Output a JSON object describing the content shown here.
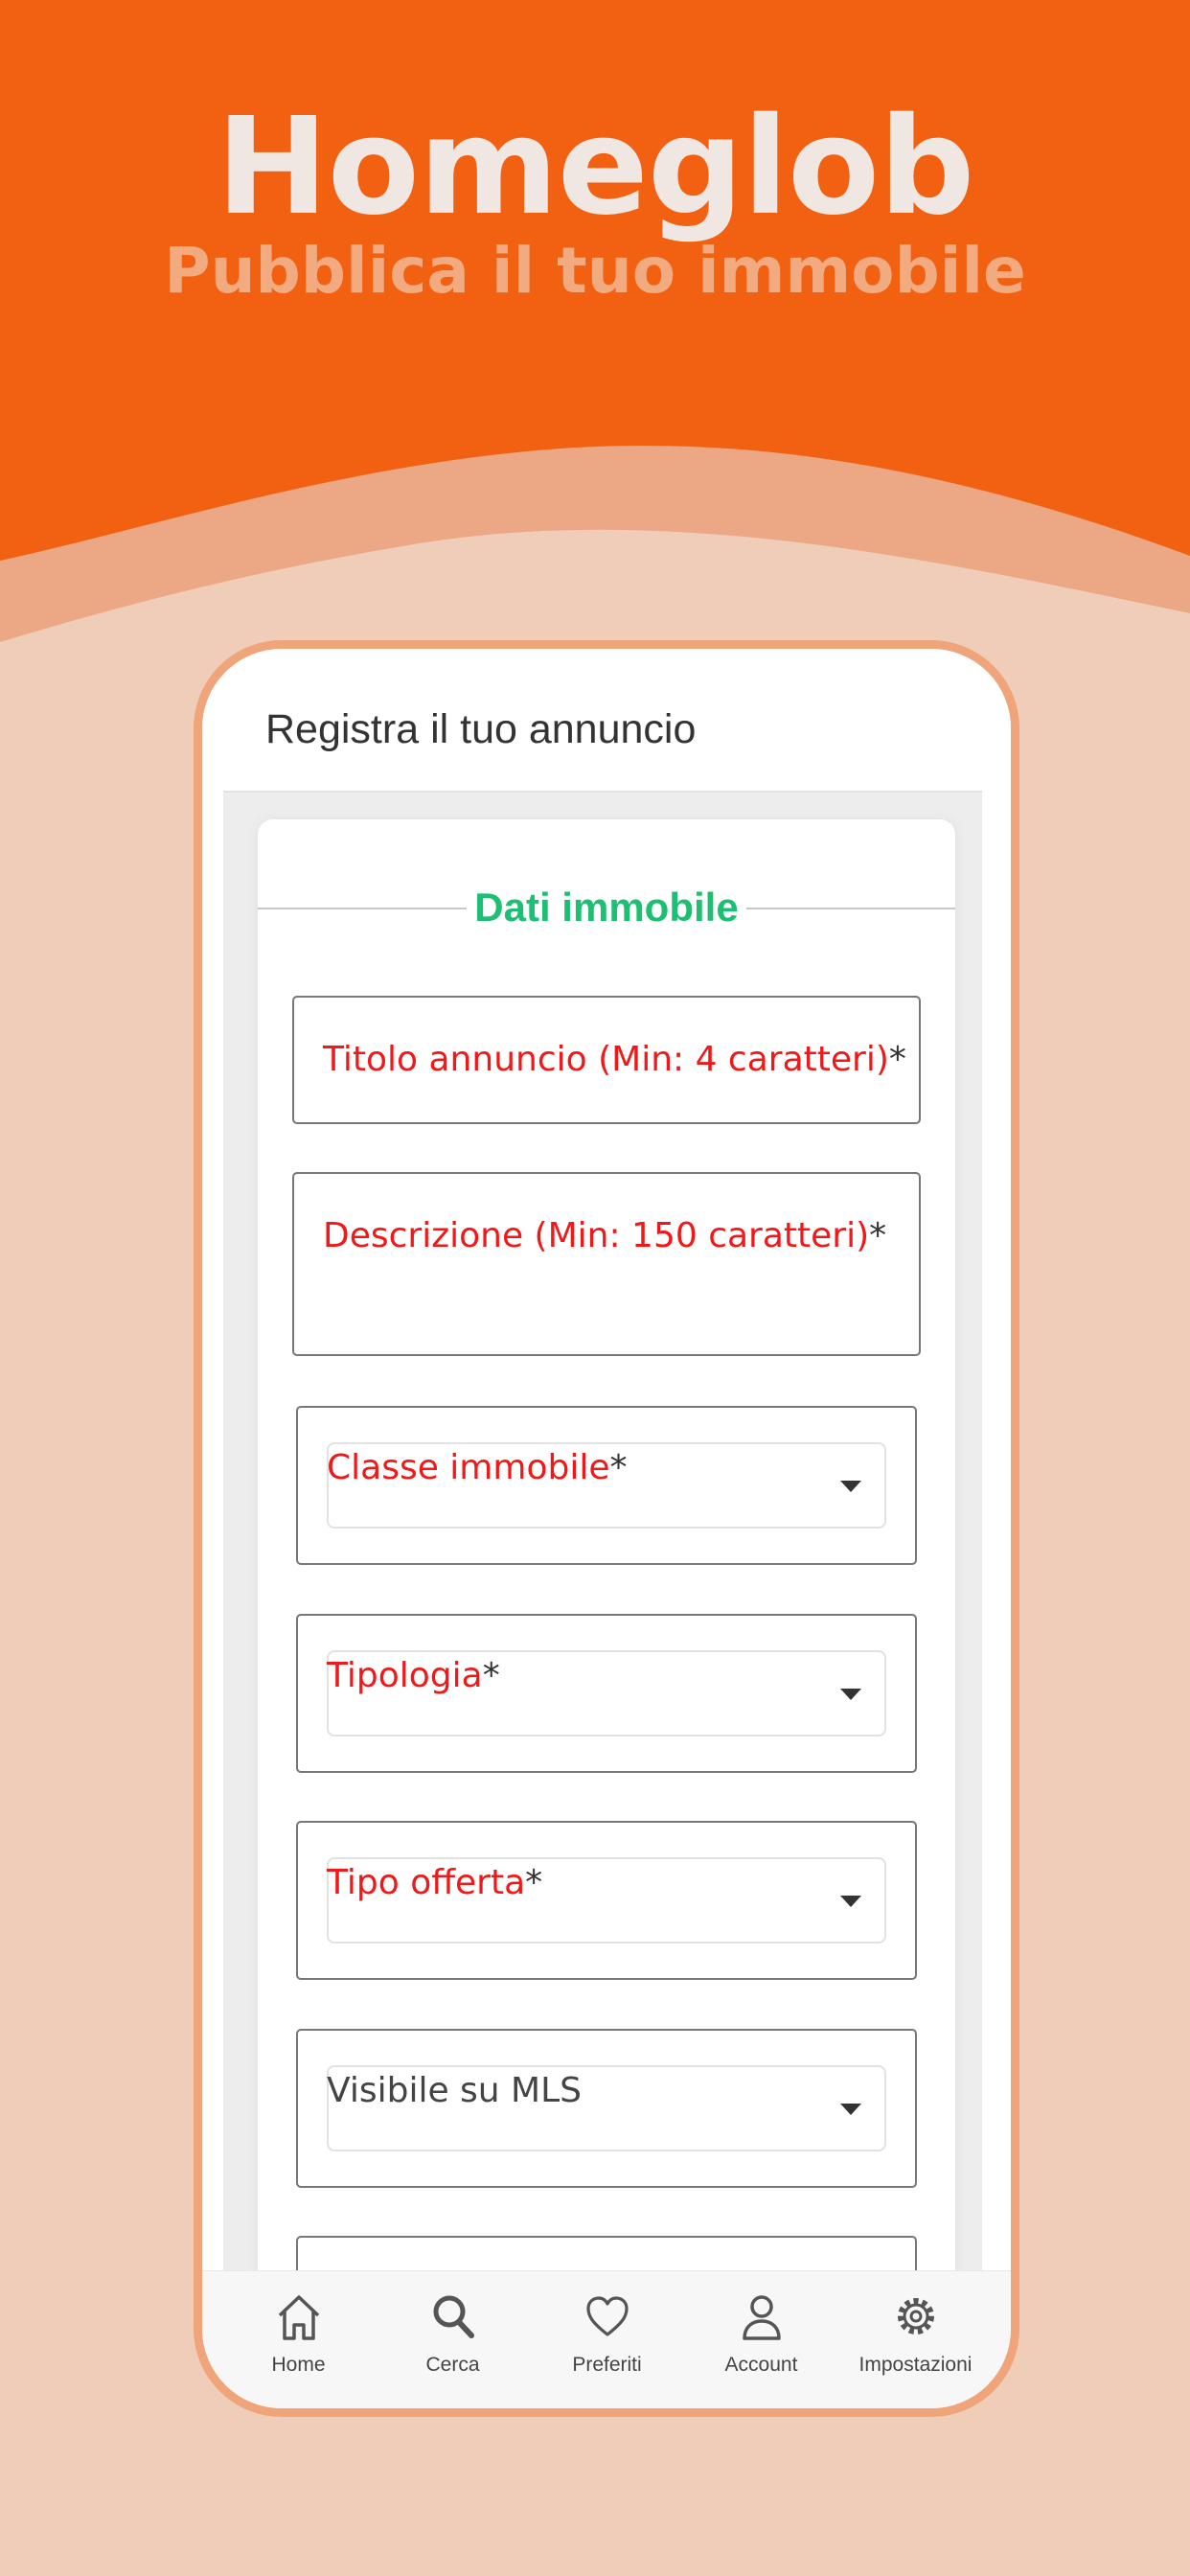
{
  "hero": {
    "title": "Homeglob",
    "subtitle": "Pubblica il tuo immobile"
  },
  "colors": {
    "brand_orange": "#F26112",
    "accent_green": "#1DBF73",
    "required_red": "#F01818"
  },
  "app": {
    "header_title": "Registra il tuo annuncio",
    "section_title": "Dati immobile",
    "fields": [
      {
        "label": "Titolo annuncio (Min: 4 caratteri)",
        "required_mark": "*",
        "type": "text"
      },
      {
        "label": "Descrizione (Min: 150 caratteri)",
        "required_mark": "*",
        "type": "textarea"
      },
      {
        "label": "Classe immobile",
        "required_mark": "*",
        "type": "select"
      },
      {
        "label": "Tipologia",
        "required_mark": "*",
        "type": "select"
      },
      {
        "label": "Tipo offerta",
        "required_mark": "*",
        "type": "select"
      },
      {
        "label": "Visibile su MLS",
        "required_mark": "",
        "type": "select"
      }
    ],
    "tabs": [
      {
        "label": "Home",
        "icon": "home-icon"
      },
      {
        "label": "Cerca",
        "icon": "search-icon"
      },
      {
        "label": "Preferiti",
        "icon": "heart-icon"
      },
      {
        "label": "Account",
        "icon": "user-icon"
      },
      {
        "label": "Impostazioni",
        "icon": "gear-icon"
      }
    ]
  }
}
